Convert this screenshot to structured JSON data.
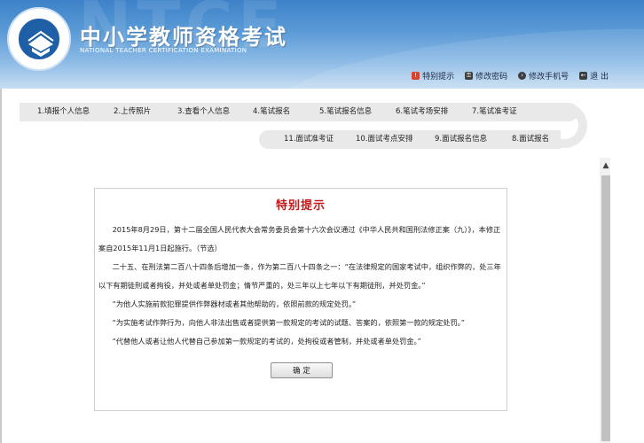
{
  "header": {
    "title_cn": "中小学教师资格考试",
    "title_en": "NATIONAL TEACHER CERTIFICATION EXAMINATION",
    "watermark": "NTCE",
    "links": [
      {
        "label": "特别提示",
        "icon": "alert-icon",
        "color": "#d9412b"
      },
      {
        "label": "修改密码",
        "icon": "key-icon",
        "color": "#3d3d3d"
      },
      {
        "label": "修改手机号",
        "icon": "phone-icon",
        "color": "#3d3d3d"
      },
      {
        "label": "退 出",
        "icon": "logout-icon",
        "color": "#3d3d3d"
      }
    ]
  },
  "steps_row1": [
    "1.填报个人信息",
    "2.上传照片",
    "3.查看个人信息",
    "4.笔试报名",
    "5.笔试报名信息",
    "6.笔试考场安排",
    "7.笔试准考证"
  ],
  "steps_row2": [
    "11.面试准考证",
    "10.面试考点安排",
    "9.面试报名信息",
    "8.面试报名"
  ],
  "notice": {
    "title": "特别提示",
    "paragraphs": [
      "2015年8月29日，第十二届全国人民代表大会常务委员会第十六次会议通过《中华人民共和国刑法修正案（九）》，本修正案自2015年11月1日起施行。（节选）",
      "二十五、在刑法第二百八十四条后增加一条，作为第二百八十四条之一：“在法律规定的国家考试中，组织作弊的，处三年以下有期徒刑或者拘役，并处或者单处罚金；情节严重的，处三年以上七年以下有期徒刑，并处罚金。”",
      "“为他人实施前款犯罪提供作弊器材或者其他帮助的，依照前款的规定处罚。”",
      "“为实施考试作弊行为，向他人非法出售或者提供第一款规定的考试的试题、答案的，依照第一款的规定处罚。”",
      "“代替他人或者让他人代替自己参加第一款规定的考试的，处拘役或者管制，并处或者单处罚金。”"
    ],
    "ok_label": "确 定"
  },
  "colors": {
    "header_blue": "#3d82c8",
    "notice_title_red": "#c41a1a",
    "step_bar": "#e9e9e9"
  }
}
